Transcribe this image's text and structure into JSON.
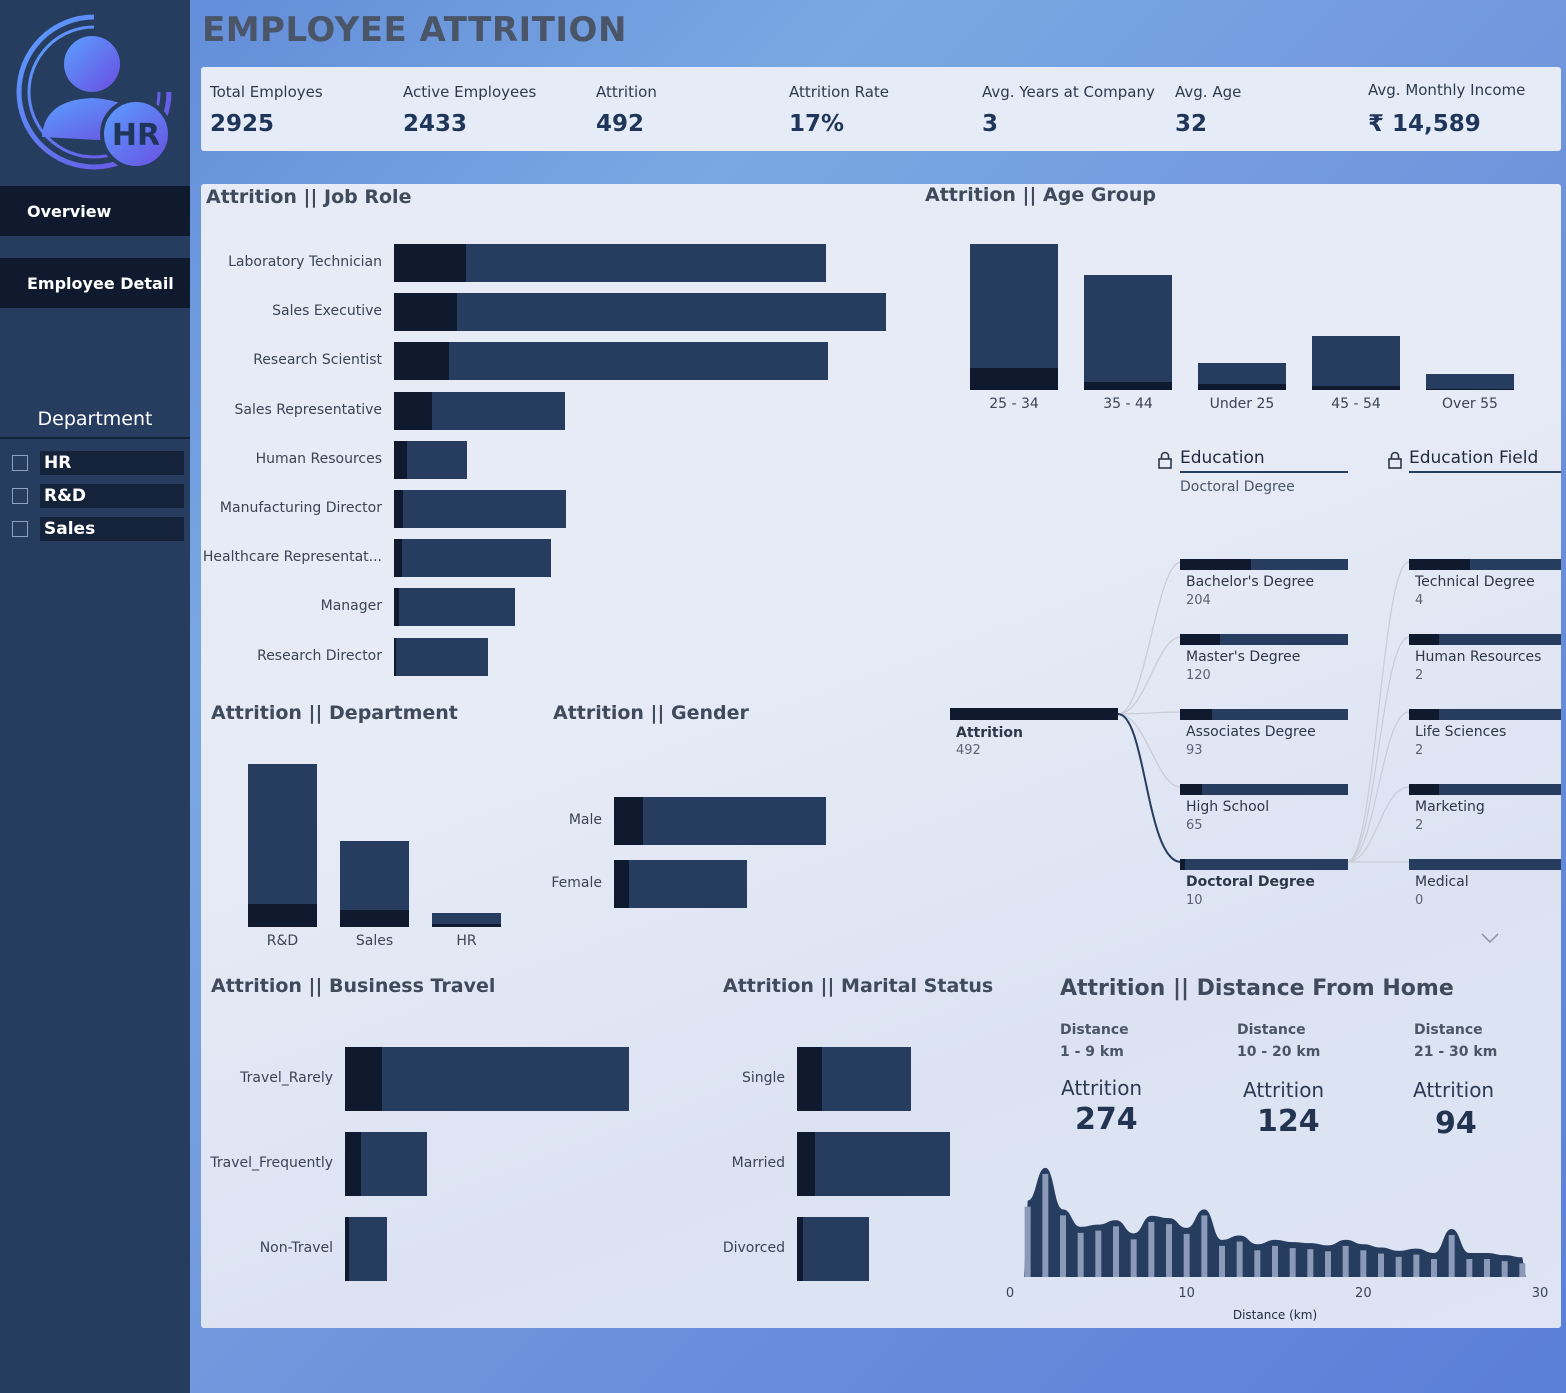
{
  "app_title": "EMPLOYEE ATTRITION",
  "sidebar": {
    "logo_text": "HR",
    "nav": [
      {
        "label": "Overview"
      },
      {
        "label": "Employee Detail"
      }
    ],
    "department_title": "Department",
    "departments": [
      {
        "label": "HR",
        "checked": false
      },
      {
        "label": "R&D",
        "checked": false
      },
      {
        "label": "Sales",
        "checked": false
      }
    ]
  },
  "kpis": [
    {
      "label": "Total Employes",
      "value": "2925"
    },
    {
      "label": "Active Employees",
      "value": "2433"
    },
    {
      "label": "Attrition",
      "value": "492"
    },
    {
      "label": "Attrition Rate",
      "value": "17%"
    },
    {
      "label": "Avg. Years at Company",
      "value": "3"
    },
    {
      "label": "Avg. Age",
      "value": "32"
    },
    {
      "label": "Avg. Monthly Income",
      "value": "₹ 14,589"
    }
  ],
  "colors": {
    "dark": "#0f1a2e",
    "mid": "#263d5f",
    "panel": "#e6ebf6"
  },
  "chart_data": [
    {
      "type": "bar",
      "title": "Attrition || Job Role",
      "categories": [
        "Laboratory Technician",
        "Sales Executive",
        "Research Scientist",
        "Sales Representative",
        "Human Resources",
        "Manufacturing Director",
        "Healthcare Representat...",
        "Manager",
        "Research Director"
      ],
      "series": [
        {
          "values": [
            124,
            108,
            94,
            66,
            22,
            16,
            14,
            8,
            4
          ]
        },
        {
          "values": [
            620,
            740,
            655,
            228,
            104,
            280,
            256,
            200,
            158
          ]
        }
      ]
    },
    {
      "type": "bar",
      "title": "Attrition || Age Group",
      "categories": [
        "25 - 34",
        "35 - 44",
        "Under 25",
        "45 - 54",
        "Over 55"
      ],
      "series": [
        {
          "values": [
            220,
            78,
            64,
            40,
            14
          ]
        },
        {
          "values": [
            1240,
            1070,
            210,
            500,
            150
          ]
        }
      ]
    },
    {
      "type": "bar",
      "title": "Attrition || Department",
      "categories": [
        "R&D",
        "Sales",
        "HR"
      ],
      "series": [
        {
          "values": [
            266,
            196,
            30
          ]
        },
        {
          "values": [
            1652,
            816,
            132
          ]
        }
      ]
    },
    {
      "type": "bar",
      "title": "Attrition || Gender",
      "categories": [
        "Male",
        "Female"
      ],
      "series": [
        {
          "values": [
            296,
            160
          ]
        },
        {
          "values": [
            1900,
            1220
          ]
        }
      ]
    },
    {
      "type": "bar",
      "title": "Attrition || Business Travel",
      "categories": [
        "Travel_Rarely",
        "Travel_Frequently",
        "Non-Travel"
      ],
      "series": [
        {
          "values": [
            312,
            138,
            32
          ]
        },
        {
          "values": [
            2070,
            550,
            320
          ]
        }
      ]
    },
    {
      "type": "bar",
      "title": "Attrition || Marital Status",
      "categories": [
        "Single",
        "Married",
        "Divorced"
      ],
      "series": [
        {
          "values": [
            236,
            168,
            62
          ]
        },
        {
          "values": [
            860,
            1300,
            630
          ]
        }
      ]
    },
    {
      "type": "bar",
      "title": "Attrition || Distance From Home",
      "xlabel": "Distance (km)",
      "xlim": [
        0,
        30
      ],
      "xticks": [
        0,
        10,
        20,
        30
      ],
      "x": [
        1,
        2,
        3,
        4,
        5,
        6,
        7,
        8,
        9,
        10,
        11,
        12,
        13,
        14,
        15,
        16,
        17,
        18,
        19,
        20,
        21,
        22,
        23,
        24,
        25,
        26,
        27,
        28,
        29
      ],
      "values": [
        70,
        100,
        62,
        46,
        48,
        52,
        40,
        56,
        54,
        45,
        62,
        34,
        38,
        30,
        34,
        32,
        31,
        29,
        34,
        30,
        27,
        24,
        26,
        22,
        44,
        22,
        22,
        20,
        18
      ]
    }
  ],
  "tree": {
    "education_header": "Education",
    "education_selected": "Doctoral Degree",
    "field_header": "Education Field",
    "root": {
      "label": "Attrition",
      "value": "492"
    },
    "education": [
      {
        "label": "Bachelor's Degree",
        "value": "204",
        "share": 0.42
      },
      {
        "label": "Master's Degree",
        "value": "120",
        "share": 0.24
      },
      {
        "label": "Associates Degree",
        "value": "93",
        "share": 0.19
      },
      {
        "label": "High School",
        "value": "65",
        "share": 0.13
      },
      {
        "label": "Doctoral Degree",
        "value": "10",
        "share": 0.03
      }
    ],
    "fields": [
      {
        "label": "Technical Degree",
        "value": "4",
        "share": 0.4
      },
      {
        "label": "Human Resources",
        "value": "2",
        "share": 0.2
      },
      {
        "label": "Life Sciences",
        "value": "2",
        "share": 0.2
      },
      {
        "label": "Marketing",
        "value": "2",
        "share": 0.2
      },
      {
        "label": "Medical",
        "value": "0",
        "share": 0.0
      }
    ]
  },
  "distance": {
    "cards": [
      {
        "head1": "Distance",
        "head2": "1 - 9 km",
        "label": "Attrition",
        "value": "274"
      },
      {
        "head1": "Distance",
        "head2": "10 - 20 km",
        "label": "Attrition",
        "value": "124"
      },
      {
        "head1": "Distance",
        "head2": "21 - 30 km",
        "label": "Attrition",
        "value": "94"
      }
    ]
  }
}
